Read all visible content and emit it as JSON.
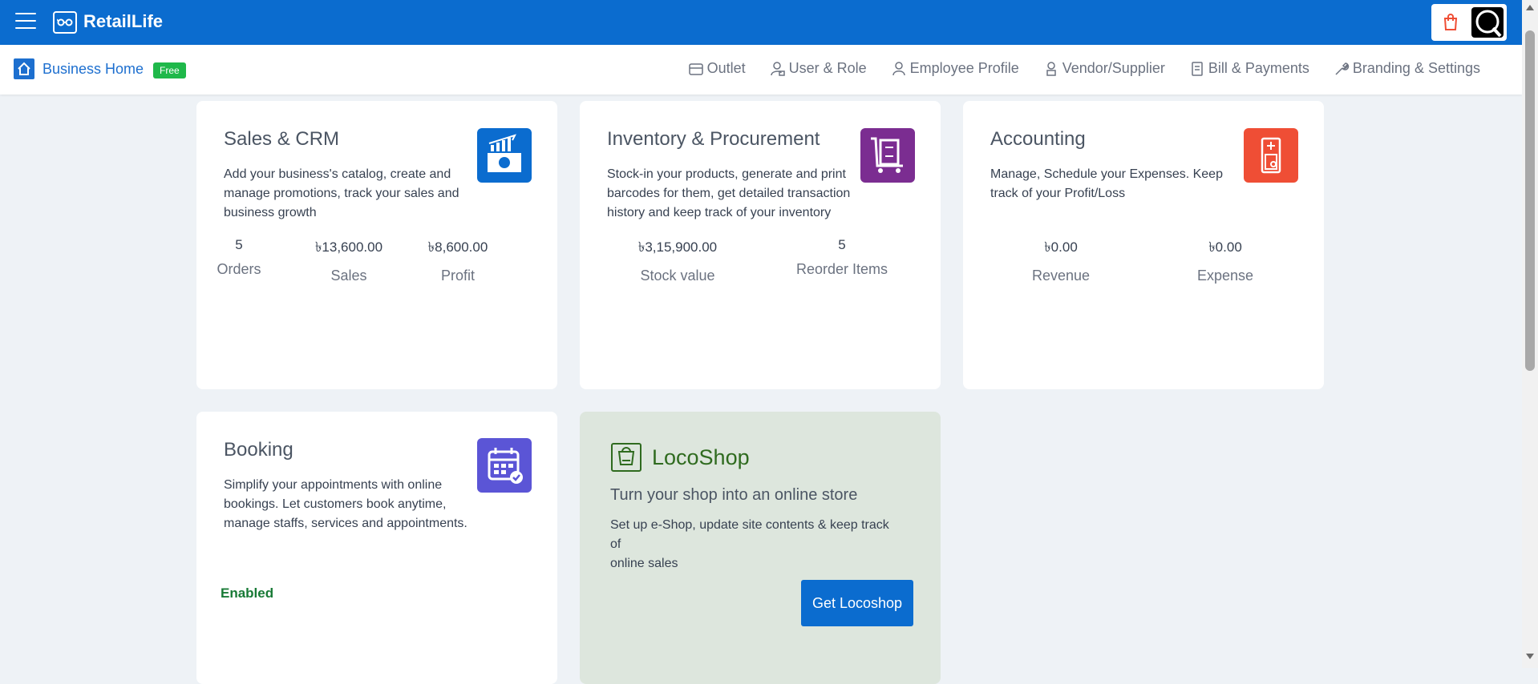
{
  "app": {
    "title": "RetailLife"
  },
  "nav": {
    "home_label": "Business Home",
    "plan_badge": "Free",
    "items": [
      {
        "label": "Outlet",
        "icon": "store-icon"
      },
      {
        "label": "User & Role",
        "icon": "user-lock-icon"
      },
      {
        "label": "Employee Profile",
        "icon": "person-icon"
      },
      {
        "label": "Vendor/Supplier",
        "icon": "vendor-icon"
      },
      {
        "label": "Bill & Payments",
        "icon": "bill-icon"
      },
      {
        "label": "Branding & Settings",
        "icon": "wrench-icon"
      }
    ]
  },
  "cards": {
    "sales": {
      "title": "Sales & CRM",
      "desc_lines": [
        "Add your business's catalog, create and",
        "manage promotions, track your sales and",
        "business growth"
      ],
      "stats": [
        {
          "value": "5",
          "label": "Orders"
        },
        {
          "value": "৳13,600.00",
          "label": "Sales"
        },
        {
          "value": "৳8,600.00",
          "label": "Profit"
        }
      ],
      "icon_color": "#0b6ccf"
    },
    "inventory": {
      "title": "Inventory & Procurement",
      "desc_lines": [
        "Stock-in your products, generate and print",
        "barcodes for them, get detailed transaction",
        "history and keep track of your inventory"
      ],
      "stats": [
        {
          "value": "৳3,15,900.00",
          "label": "Stock value"
        },
        {
          "value": "5",
          "label": "Reorder Items"
        }
      ],
      "icon_color": "#7b2d91"
    },
    "accounting": {
      "title": "Accounting",
      "desc_lines": [
        "Manage, Schedule your Expenses. Keep",
        "track of your Profit/Loss"
      ],
      "stats": [
        {
          "value": "৳0.00",
          "label": "Revenue"
        },
        {
          "value": "৳0.00",
          "label": "Expense"
        }
      ],
      "icon_color": "#ef4e35"
    },
    "booking": {
      "title": "Booking",
      "desc_lines": [
        "Simplify your appointments with online",
        "bookings. Let customers book anytime,",
        "manage staffs, services and appointments."
      ],
      "status": "Enabled",
      "icon_color": "#5b55d6"
    },
    "locoshop": {
      "title": "LocoShop",
      "subtitle": "Turn your shop into an online store",
      "desc_lines": [
        "Set up e-Shop, update site contents & keep track of",
        "online sales"
      ],
      "button_label": "Get Locoshop"
    }
  }
}
